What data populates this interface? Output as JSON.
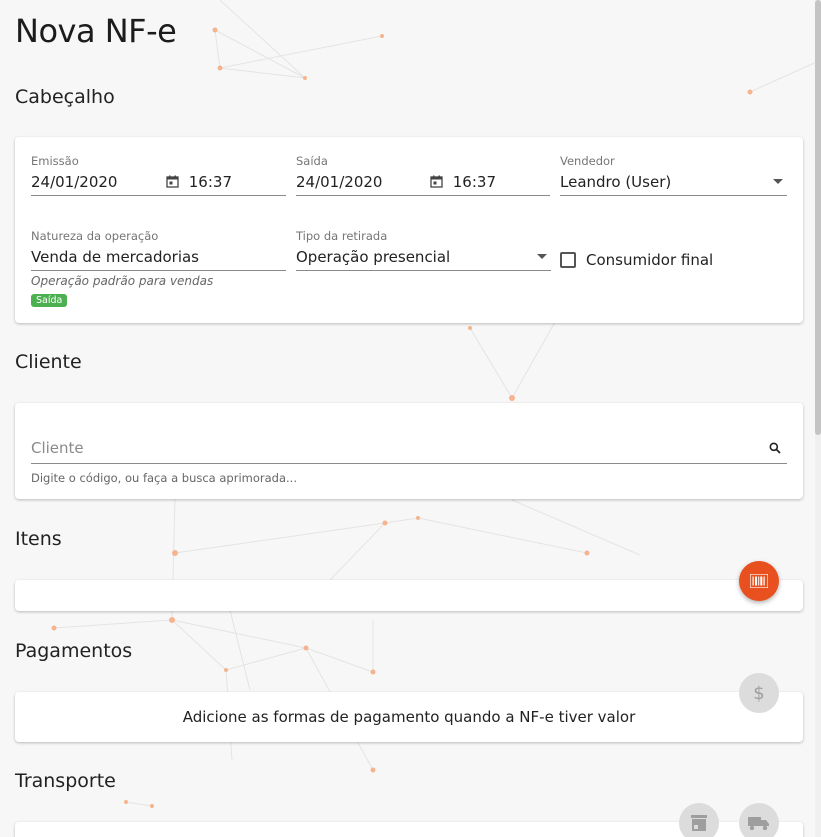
{
  "page": {
    "title": "Nova NF-e"
  },
  "sections": {
    "header": "Cabeçalho",
    "client": "Cliente",
    "items": "Itens",
    "payments": "Pagamentos",
    "transport": "Transporte"
  },
  "header": {
    "emissao": {
      "label": "Emissão",
      "date": "24/01/2020",
      "time": "16:37"
    },
    "saida": {
      "label": "Saída",
      "date": "24/01/2020",
      "time": "16:37"
    },
    "vendedor": {
      "label": "Vendedor",
      "value": "Leandro (User)"
    },
    "natureza": {
      "label": "Natureza da operação",
      "value": "Venda de mercadorias",
      "hint": "Operação padrão para vendas",
      "badge": "Saída"
    },
    "tipo_retirada": {
      "label": "Tipo da retirada",
      "value": "Operação presencial"
    },
    "consumidor_final": {
      "label": "Consumidor final",
      "checked": false
    }
  },
  "client": {
    "placeholder": "Cliente",
    "hint": "Digite o código, ou faça a busca aprimorada..."
  },
  "payments": {
    "message": "Adicione as formas de pagamento quando a NF-e tiver valor"
  },
  "colors": {
    "accent": "#e8511f",
    "badge": "#4caf50"
  },
  "icons": {
    "barcode": "barcode-icon",
    "dollar": "dollar-icon",
    "store": "store-icon",
    "truck": "truck-icon",
    "calendar": "calendar-icon",
    "search": "search-icon"
  }
}
